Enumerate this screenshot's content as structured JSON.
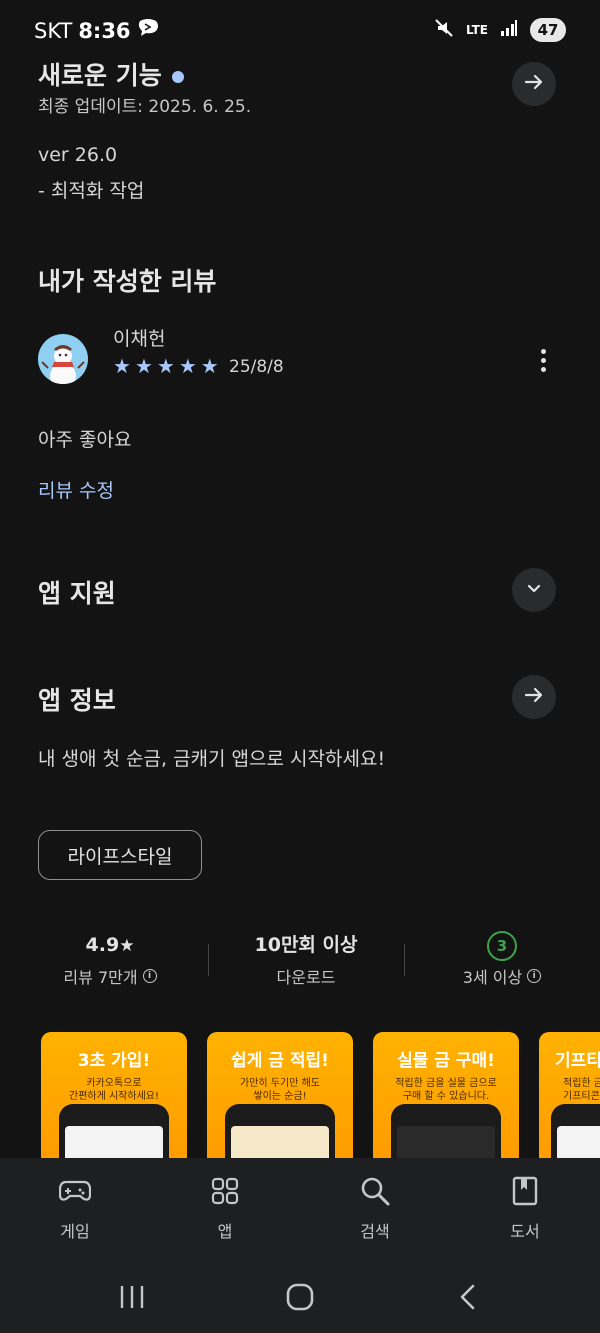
{
  "status_bar": {
    "carrier": "SKT",
    "time": "8:36",
    "network": "LTE",
    "battery": "47",
    "icons": [
      "chat-bubble-icon",
      "mute-icon",
      "lte-icon",
      "signal-icon",
      "battery-icon"
    ]
  },
  "whats_new": {
    "title": "새로운 기능",
    "updated": "최종 업데이트: 2025. 6. 25.",
    "version": "ver 26.0",
    "note": "- 최적화 작업"
  },
  "my_review": {
    "section_title": "내가 작성한 리뷰",
    "reviewer": "이채헌",
    "rating": 5,
    "date": "25/8/8",
    "text": "아주 좋아요",
    "edit_link": "리뷰 수정"
  },
  "app_support": {
    "title": "앱 지원"
  },
  "app_info": {
    "title": "앱 정보",
    "description": "내 생애 첫 순금, 금캐기 앱으로 시작하세요!",
    "category_chip": "라이프스타일"
  },
  "stats": {
    "rating": {
      "value": "4.9",
      "star": "★",
      "label": "리뷰 7만개"
    },
    "downloads": {
      "value": "10만회 이상",
      "label": "다운로드"
    },
    "age": {
      "badge": "3",
      "label": "3세 이상"
    }
  },
  "screenshots": [
    {
      "headline": "3초 가입!",
      "sub1": "카카오톡으로",
      "sub2": "간편하게 시작하세요!"
    },
    {
      "headline": "쉽게 금 적립!",
      "sub1": "가만히 두기만 해도",
      "sub2": "쌓이는 순금!"
    },
    {
      "headline": "실물 금 구매!",
      "sub1": "적립한 금을 실물 금으로",
      "sub2": "구매 할 수 있습니다."
    },
    {
      "headline": "기프티",
      "sub1": "적립한 금",
      "sub2": "기프티콘"
    }
  ],
  "bottom_nav": [
    {
      "label": "게임",
      "icon": "gamepad-icon"
    },
    {
      "label": "앱",
      "icon": "apps-grid-icon"
    },
    {
      "label": "검색",
      "icon": "search-icon"
    },
    {
      "label": "도서",
      "icon": "book-icon"
    }
  ],
  "colors": {
    "background": "#131314",
    "accent": "#a8c7fa",
    "card": "#2a2b2d",
    "screenshot_orange": "#ffa800",
    "age_green": "#3fa34d"
  }
}
